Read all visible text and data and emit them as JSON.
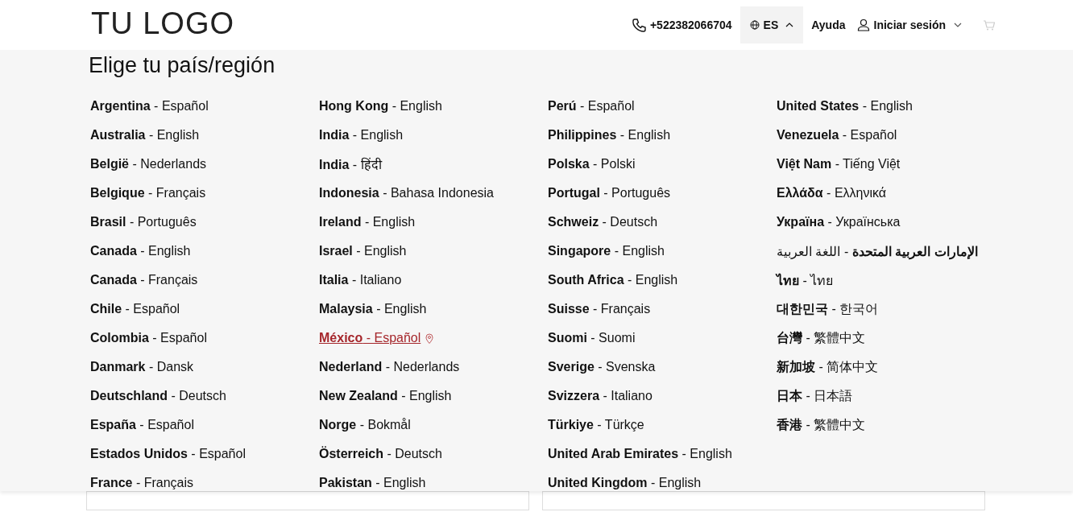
{
  "header": {
    "logo": "TU LOGO",
    "phone": "+522382066704",
    "language": {
      "label": "ES",
      "expanded": true
    },
    "help": "Ayuda",
    "login": "Iniciar sesión"
  },
  "region_panel": {
    "title": "Elige tu país/región",
    "columns": [
      [
        {
          "label": "**Argentina** - Español",
          "selected": false
        },
        {
          "label": "**Australia** - English",
          "selected": false
        },
        {
          "label": "**België** - Nederlands",
          "selected": false
        },
        {
          "label": "**Belgique** - Français",
          "selected": false
        },
        {
          "label": "**Brasil** - Português",
          "selected": false
        },
        {
          "label": "**Canada** - English",
          "selected": false
        },
        {
          "label": "**Canada** - Français",
          "selected": false
        },
        {
          "label": "**Chile** - Español",
          "selected": false
        },
        {
          "label": "**Colombia** - Español",
          "selected": false
        },
        {
          "label": "**Danmark** - Dansk",
          "selected": false
        },
        {
          "label": "**Deutschland** - Deutsch",
          "selected": false
        },
        {
          "label": "**España** - Español",
          "selected": false
        },
        {
          "label": "**Estados Unidos** - Español",
          "selected": false
        },
        {
          "label": "**France** - Français",
          "selected": false
        }
      ],
      [
        {
          "label": "**Hong Kong** - English",
          "selected": false
        },
        {
          "label": "**India** - English",
          "selected": false
        },
        {
          "label": "**India** - हिंदी",
          "selected": false
        },
        {
          "label": "**Indonesia** - Bahasa Indonesia",
          "selected": false
        },
        {
          "label": "**Ireland** - English",
          "selected": false
        },
        {
          "label": "**Israel** - English",
          "selected": false
        },
        {
          "label": "**Italia** - Italiano",
          "selected": false
        },
        {
          "label": "**Malaysia** - English",
          "selected": false
        },
        {
          "label": "**México** - Español",
          "selected": true
        },
        {
          "label": "**Nederland** - Nederlands",
          "selected": false
        },
        {
          "label": "**New Zealand** - English",
          "selected": false
        },
        {
          "label": "**Norge** - Bokmål",
          "selected": false
        },
        {
          "label": "**Österreich** - Deutsch",
          "selected": false
        },
        {
          "label": "**Pakistan** - English",
          "selected": false
        }
      ],
      [
        {
          "label": "**Perú** - Español",
          "selected": false
        },
        {
          "label": "**Philippines** - English",
          "selected": false
        },
        {
          "label": "**Polska** - Polski",
          "selected": false
        },
        {
          "label": "**Portugal** - Português",
          "selected": false
        },
        {
          "label": "**Schweiz** - Deutsch",
          "selected": false
        },
        {
          "label": "**Singapore** - English",
          "selected": false
        },
        {
          "label": "**South Africa** - English",
          "selected": false
        },
        {
          "label": "**Suisse** - Français",
          "selected": false
        },
        {
          "label": "**Suomi** - Suomi",
          "selected": false
        },
        {
          "label": "**Sverige** - Svenska",
          "selected": false
        },
        {
          "label": "**Svizzera** - Italiano",
          "selected": false
        },
        {
          "label": "**Türkiye** - Türkçe",
          "selected": false
        },
        {
          "label": "**United Arab Emirates** - English",
          "selected": false
        },
        {
          "label": "**United Kingdom** - English",
          "selected": false
        }
      ],
      [
        {
          "label": "**United States** - English",
          "selected": false
        },
        {
          "label": "**Venezuela** - Español",
          "selected": false
        },
        {
          "label": "**Việt Nam** - Tiếng Việt",
          "selected": false
        },
        {
          "label": "**Ελλάδα** - Ελληνικά",
          "selected": false
        },
        {
          "label": "**Україна** - Українська",
          "selected": false
        },
        {
          "label": "**الإمارات العربية المتحدة** - اللغة العربية",
          "selected": false
        },
        {
          "label": "**ไทย** - ไทย",
          "selected": false
        },
        {
          "label": "**대한민국** - 한국어",
          "selected": false
        },
        {
          "label": "**台灣** - 繁體中文",
          "selected": false
        },
        {
          "label": "**新加坡** - 简体中文",
          "selected": false
        },
        {
          "label": "**日本** - 日本語",
          "selected": false
        },
        {
          "label": "**香港** - 繁體中文",
          "selected": false
        }
      ]
    ]
  }
}
